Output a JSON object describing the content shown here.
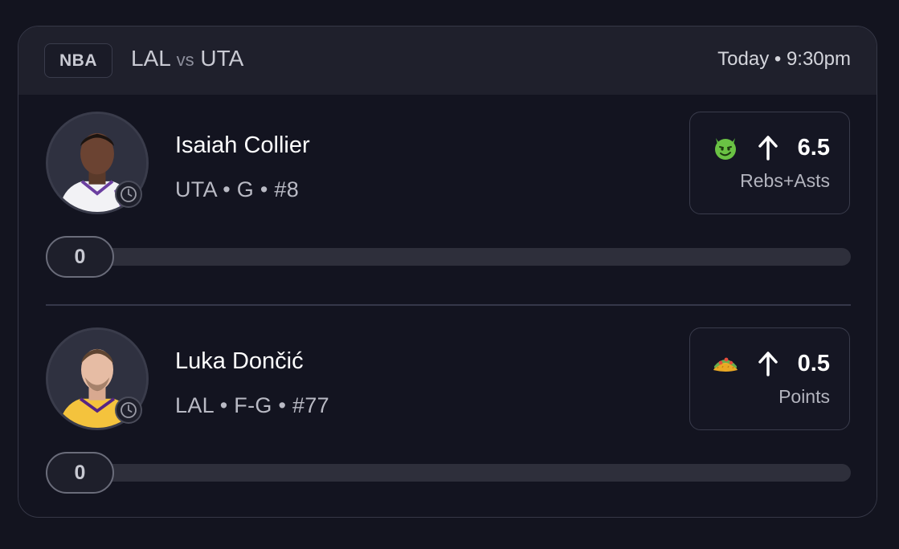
{
  "header": {
    "league": "NBA",
    "home_team": "LAL",
    "vs": "vs",
    "away_team": "UTA",
    "game_time": "Today • 9:30pm"
  },
  "players": [
    {
      "name": "Isaiah Collier",
      "meta": "UTA • G • #8",
      "jersey_color": "#f2f2f5",
      "jersey_trim": "#6b3fa0",
      "pick_emoji": "devil-emoji",
      "pick_direction": "up-arrow-icon",
      "pick_line": "6.5",
      "pick_stat": "Rebs+Asts",
      "progress_value": "0",
      "progress_fraction": 0
    },
    {
      "name": "Luka Dončić",
      "meta": "LAL • F-G • #77",
      "jersey_color": "#f4c33d",
      "jersey_trim": "#552583",
      "pick_emoji": "taco-emoji",
      "pick_direction": "up-arrow-icon",
      "pick_line": "0.5",
      "pick_stat": "Points",
      "progress_value": "0",
      "progress_fraction": 0
    }
  ]
}
